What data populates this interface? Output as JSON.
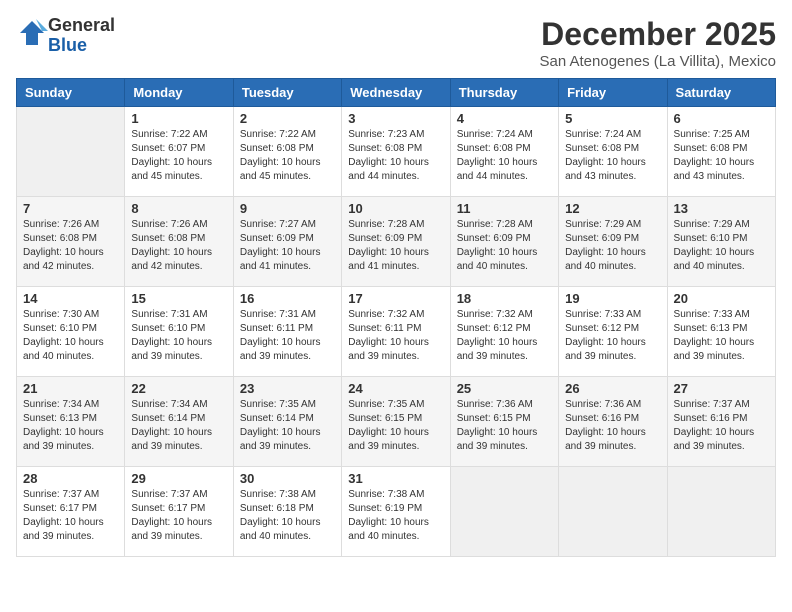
{
  "header": {
    "logo_general": "General",
    "logo_blue": "Blue",
    "month_year": "December 2025",
    "location": "San Atenogenes (La Villita), Mexico"
  },
  "days_of_week": [
    "Sunday",
    "Monday",
    "Tuesday",
    "Wednesday",
    "Thursday",
    "Friday",
    "Saturday"
  ],
  "weeks": [
    [
      {
        "day": "",
        "sunrise": "",
        "sunset": "",
        "daylight": ""
      },
      {
        "day": "1",
        "sunrise": "Sunrise: 7:22 AM",
        "sunset": "Sunset: 6:07 PM",
        "daylight": "Daylight: 10 hours and 45 minutes."
      },
      {
        "day": "2",
        "sunrise": "Sunrise: 7:22 AM",
        "sunset": "Sunset: 6:08 PM",
        "daylight": "Daylight: 10 hours and 45 minutes."
      },
      {
        "day": "3",
        "sunrise": "Sunrise: 7:23 AM",
        "sunset": "Sunset: 6:08 PM",
        "daylight": "Daylight: 10 hours and 44 minutes."
      },
      {
        "day": "4",
        "sunrise": "Sunrise: 7:24 AM",
        "sunset": "Sunset: 6:08 PM",
        "daylight": "Daylight: 10 hours and 44 minutes."
      },
      {
        "day": "5",
        "sunrise": "Sunrise: 7:24 AM",
        "sunset": "Sunset: 6:08 PM",
        "daylight": "Daylight: 10 hours and 43 minutes."
      },
      {
        "day": "6",
        "sunrise": "Sunrise: 7:25 AM",
        "sunset": "Sunset: 6:08 PM",
        "daylight": "Daylight: 10 hours and 43 minutes."
      }
    ],
    [
      {
        "day": "7",
        "sunrise": "Sunrise: 7:26 AM",
        "sunset": "Sunset: 6:08 PM",
        "daylight": "Daylight: 10 hours and 42 minutes."
      },
      {
        "day": "8",
        "sunrise": "Sunrise: 7:26 AM",
        "sunset": "Sunset: 6:08 PM",
        "daylight": "Daylight: 10 hours and 42 minutes."
      },
      {
        "day": "9",
        "sunrise": "Sunrise: 7:27 AM",
        "sunset": "Sunset: 6:09 PM",
        "daylight": "Daylight: 10 hours and 41 minutes."
      },
      {
        "day": "10",
        "sunrise": "Sunrise: 7:28 AM",
        "sunset": "Sunset: 6:09 PM",
        "daylight": "Daylight: 10 hours and 41 minutes."
      },
      {
        "day": "11",
        "sunrise": "Sunrise: 7:28 AM",
        "sunset": "Sunset: 6:09 PM",
        "daylight": "Daylight: 10 hours and 40 minutes."
      },
      {
        "day": "12",
        "sunrise": "Sunrise: 7:29 AM",
        "sunset": "Sunset: 6:09 PM",
        "daylight": "Daylight: 10 hours and 40 minutes."
      },
      {
        "day": "13",
        "sunrise": "Sunrise: 7:29 AM",
        "sunset": "Sunset: 6:10 PM",
        "daylight": "Daylight: 10 hours and 40 minutes."
      }
    ],
    [
      {
        "day": "14",
        "sunrise": "Sunrise: 7:30 AM",
        "sunset": "Sunset: 6:10 PM",
        "daylight": "Daylight: 10 hours and 40 minutes."
      },
      {
        "day": "15",
        "sunrise": "Sunrise: 7:31 AM",
        "sunset": "Sunset: 6:10 PM",
        "daylight": "Daylight: 10 hours and 39 minutes."
      },
      {
        "day": "16",
        "sunrise": "Sunrise: 7:31 AM",
        "sunset": "Sunset: 6:11 PM",
        "daylight": "Daylight: 10 hours and 39 minutes."
      },
      {
        "day": "17",
        "sunrise": "Sunrise: 7:32 AM",
        "sunset": "Sunset: 6:11 PM",
        "daylight": "Daylight: 10 hours and 39 minutes."
      },
      {
        "day": "18",
        "sunrise": "Sunrise: 7:32 AM",
        "sunset": "Sunset: 6:12 PM",
        "daylight": "Daylight: 10 hours and 39 minutes."
      },
      {
        "day": "19",
        "sunrise": "Sunrise: 7:33 AM",
        "sunset": "Sunset: 6:12 PM",
        "daylight": "Daylight: 10 hours and 39 minutes."
      },
      {
        "day": "20",
        "sunrise": "Sunrise: 7:33 AM",
        "sunset": "Sunset: 6:13 PM",
        "daylight": "Daylight: 10 hours and 39 minutes."
      }
    ],
    [
      {
        "day": "21",
        "sunrise": "Sunrise: 7:34 AM",
        "sunset": "Sunset: 6:13 PM",
        "daylight": "Daylight: 10 hours and 39 minutes."
      },
      {
        "day": "22",
        "sunrise": "Sunrise: 7:34 AM",
        "sunset": "Sunset: 6:14 PM",
        "daylight": "Daylight: 10 hours and 39 minutes."
      },
      {
        "day": "23",
        "sunrise": "Sunrise: 7:35 AM",
        "sunset": "Sunset: 6:14 PM",
        "daylight": "Daylight: 10 hours and 39 minutes."
      },
      {
        "day": "24",
        "sunrise": "Sunrise: 7:35 AM",
        "sunset": "Sunset: 6:15 PM",
        "daylight": "Daylight: 10 hours and 39 minutes."
      },
      {
        "day": "25",
        "sunrise": "Sunrise: 7:36 AM",
        "sunset": "Sunset: 6:15 PM",
        "daylight": "Daylight: 10 hours and 39 minutes."
      },
      {
        "day": "26",
        "sunrise": "Sunrise: 7:36 AM",
        "sunset": "Sunset: 6:16 PM",
        "daylight": "Daylight: 10 hours and 39 minutes."
      },
      {
        "day": "27",
        "sunrise": "Sunrise: 7:37 AM",
        "sunset": "Sunset: 6:16 PM",
        "daylight": "Daylight: 10 hours and 39 minutes."
      }
    ],
    [
      {
        "day": "28",
        "sunrise": "Sunrise: 7:37 AM",
        "sunset": "Sunset: 6:17 PM",
        "daylight": "Daylight: 10 hours and 39 minutes."
      },
      {
        "day": "29",
        "sunrise": "Sunrise: 7:37 AM",
        "sunset": "Sunset: 6:17 PM",
        "daylight": "Daylight: 10 hours and 39 minutes."
      },
      {
        "day": "30",
        "sunrise": "Sunrise: 7:38 AM",
        "sunset": "Sunset: 6:18 PM",
        "daylight": "Daylight: 10 hours and 40 minutes."
      },
      {
        "day": "31",
        "sunrise": "Sunrise: 7:38 AM",
        "sunset": "Sunset: 6:19 PM",
        "daylight": "Daylight: 10 hours and 40 minutes."
      },
      {
        "day": "",
        "sunrise": "",
        "sunset": "",
        "daylight": ""
      },
      {
        "day": "",
        "sunrise": "",
        "sunset": "",
        "daylight": ""
      },
      {
        "day": "",
        "sunrise": "",
        "sunset": "",
        "daylight": ""
      }
    ]
  ]
}
